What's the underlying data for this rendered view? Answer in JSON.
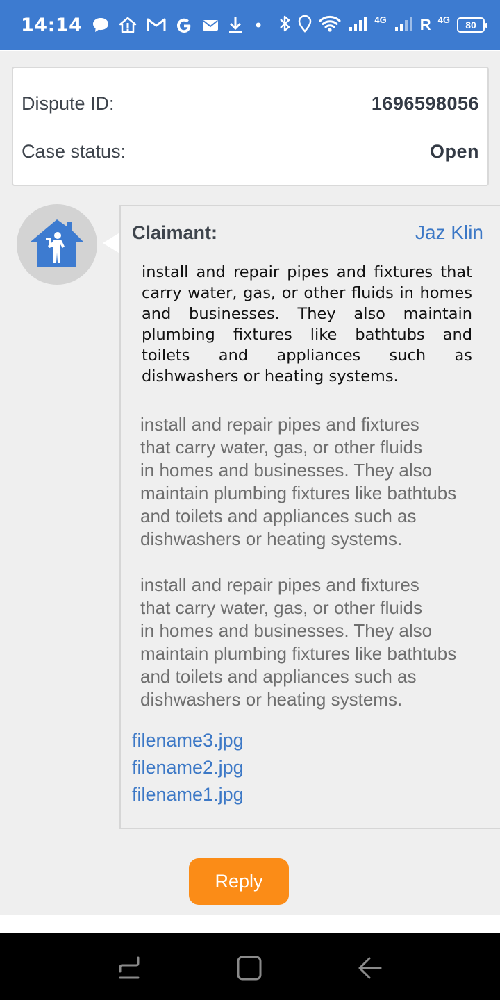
{
  "status_bar": {
    "time": "14:14",
    "network_1": "4G",
    "roaming": "R",
    "network_2": "4G",
    "battery": "80",
    "icons": [
      "chat-bubble-icon",
      "home-alert-icon",
      "gmail-icon",
      "google-icon",
      "email-icon",
      "download-icon",
      "dot-icon",
      "bluetooth-icon",
      "location-icon",
      "wifi-icon",
      "signal-icon",
      "signal-icon",
      "battery-icon"
    ]
  },
  "case": {
    "dispute_id_label": "Dispute ID:",
    "dispute_id": "1696598056",
    "status_label": "Case status:",
    "status": "Open"
  },
  "message": {
    "avatar_icon": "plumber-house-icon",
    "sender_label": "Claimant:",
    "sender_name": "Jaz Klin",
    "paragraphs": [
      "install and repair pipes and fixtures that carry water, gas, or other fluids in homes and businesses. They also maintain plumbing fixtures like bathtubs and toilets and appliances such as dishwashers or heating systems.",
      "install and repair pipes and fixtures\nthat carry water, gas, or other fluids\nin homes and businesses. They also\nmaintain plumbing fixtures like bathtubs\nand toilets and appliances such as\ndishwashers or heating systems.",
      "install and repair pipes and fixtures\nthat carry water, gas, or other fluids\nin homes and businesses. They also\nmaintain plumbing fixtures like bathtubs\nand toilets and appliances such as\ndishwashers or heating systems."
    ],
    "attachments": [
      "filename3.jpg",
      "filename2.jpg",
      "filename1.jpg"
    ]
  },
  "actions": {
    "reply_label": "Reply"
  },
  "colors": {
    "status_bar": "#3d7bd0",
    "link": "#3c78c6",
    "reply_button": "#fb8c17",
    "avatar_icon": "#3d7bd0"
  },
  "nav_bar": {
    "icons": [
      "recent-apps-icon",
      "home-icon",
      "back-icon"
    ]
  }
}
